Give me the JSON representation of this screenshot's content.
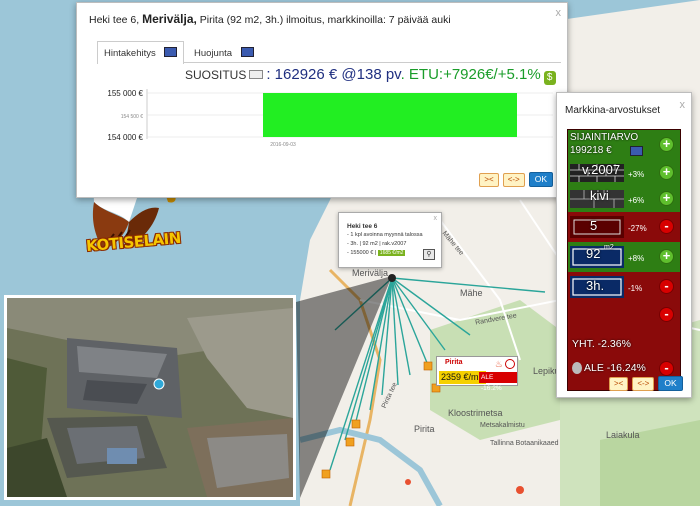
{
  "map": {
    "labels": [
      "Merivälja",
      "Mähe",
      "Pirita",
      "Kloostrimetsa",
      "Lepiku",
      "Laiakula",
      "Metsakalmistu",
      "Tallinna Botaanikaaed",
      "Pirita tee",
      "Randvere tee",
      "Mähe tee"
    ]
  },
  "main_window": {
    "title_prefix": "Heki tee 6,",
    "title_bold": "Merivälja,",
    "title_suffix": "Pirita (92 m2, 3h.) ilmoitus, markkinoilla: 7 päivää auki",
    "close": "x",
    "tabs": [
      {
        "label": "Hintakehitys",
        "icon": "chart-icon",
        "active": true
      },
      {
        "label": "Huojunta",
        "icon": "chart-icon",
        "active": false
      }
    ],
    "suositus_label": "SUOSITUS",
    "suositus_value": ": 162926 € @138 pv",
    "suositus_etu": ". ETU:+7926€/+5.1%",
    "buttons": {
      "back": "><",
      "expand": "<->",
      "ok": "OK"
    }
  },
  "chart_data": {
    "type": "bar",
    "categories": [
      "2016-09-03"
    ],
    "values": [
      155000
    ],
    "y_ticks": [
      "155 000 €",
      "154 500 €",
      "154 000 €"
    ],
    "ylim": [
      154000,
      155000
    ],
    "colors": {
      "bar": "#22ee22",
      "grid": "#dddddd"
    }
  },
  "side_panel": {
    "title": "Markkina-arvostukset",
    "close": "x",
    "rows": [
      {
        "label": "SIJAINTIARVO",
        "value": "199218 €",
        "pct": "",
        "sign": "+"
      },
      {
        "label": "v.2007",
        "pct": "+3%",
        "sign": "+"
      },
      {
        "label": "kivi",
        "pct": "+6%",
        "sign": "+"
      },
      {
        "label": "5",
        "pct": "-27%",
        "sign": "-"
      },
      {
        "label": "92",
        "sup": "m2",
        "pct": "+8%",
        "sign": "+"
      },
      {
        "label": "3h.",
        "pct": "-1%",
        "sign": "-"
      },
      {
        "label": "",
        "pct": "",
        "sign": "-"
      },
      {
        "label": "YHT. -2.36%",
        "pct": "",
        "sign": ""
      },
      {
        "label": "ALE -16.24%",
        "pct": "",
        "sign": "-"
      }
    ],
    "buttons": {
      "back": "><",
      "expand": "<->",
      "ok": "OK"
    }
  },
  "tooltip": {
    "title": "Heki tee 6",
    "lines": [
      "- 1 kpl avoinna myynnä talossa",
      "- 3h. | 92 m2 | rak.v2007",
      "- 155000 € |"
    ],
    "badge": "1685 €/m2",
    "close": "x"
  },
  "pirita_marker": {
    "title": "Pirita",
    "price": "2359 €/m2",
    "ale": "ALE -16.2%"
  },
  "logo": {
    "text": "KOTISELAIN"
  },
  "colors": {
    "water": "#9cc6d8",
    "land": "#f2efe9",
    "green_panel": "#2e7e14",
    "red_panel": "#8a0a0a",
    "accent_blue": "#1f7fc9"
  }
}
